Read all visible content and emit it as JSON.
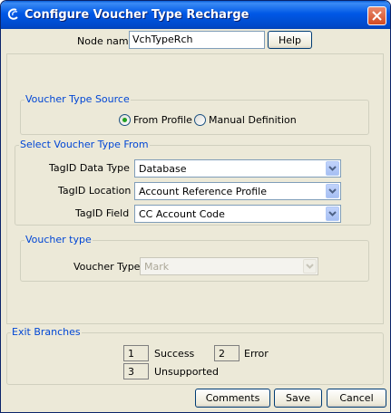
{
  "window": {
    "title": "Configure Voucher Type Recharge",
    "icon": "swirl-icon",
    "close_icon": "close-icon"
  },
  "node": {
    "label": "Node name",
    "value": "VchTypeRch",
    "help_label": "Help"
  },
  "voucher_type_source": {
    "legend": "Voucher Type Source",
    "options": [
      {
        "label": "From Profile",
        "selected": true
      },
      {
        "label": "Manual Definition",
        "selected": false
      }
    ]
  },
  "select_from": {
    "legend": "Select Voucher Type From",
    "fields": [
      {
        "label": "TagID Data Type",
        "value": "Database"
      },
      {
        "label": "TagID Location",
        "value": "Account Reference Profile"
      },
      {
        "label": "TagID Field",
        "value": "CC Account Code"
      }
    ]
  },
  "voucher_type": {
    "legend": "Voucher type",
    "label": "Voucher Type",
    "value": "Mark",
    "enabled": false
  },
  "exit_branches": {
    "legend": "Exit Branches",
    "items": [
      {
        "number": "1",
        "label": "Success"
      },
      {
        "number": "2",
        "label": "Error"
      },
      {
        "number": "3",
        "label": "Unsupported"
      }
    ]
  },
  "buttons": {
    "comments": "Comments",
    "save": "Save",
    "cancel": "Cancel"
  },
  "colors": {
    "title_bar": "#0058e6",
    "legend_text": "#0046d5",
    "window_bg": "#ece9d8",
    "radio_selected": "#21a121"
  }
}
